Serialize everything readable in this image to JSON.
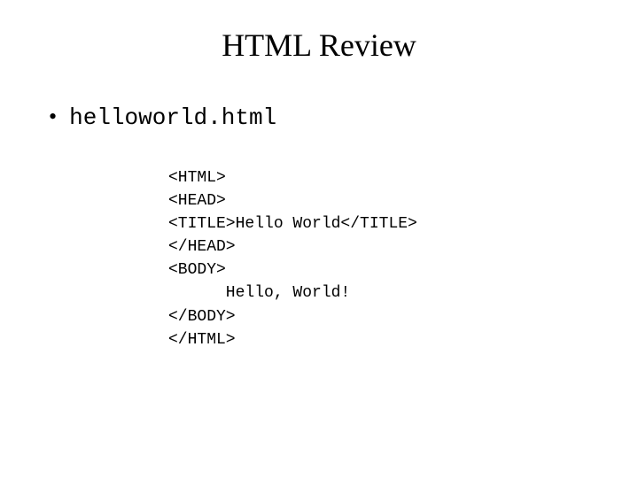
{
  "slide": {
    "title": "HTML Review",
    "bullet": {
      "marker": "•",
      "filename": "helloworld.html"
    },
    "code": "<HTML>\n<HEAD>\n<TITLE>Hello World</TITLE>\n</HEAD>\n<BODY>\n      Hello, World!\n</BODY>\n</HTML>"
  }
}
